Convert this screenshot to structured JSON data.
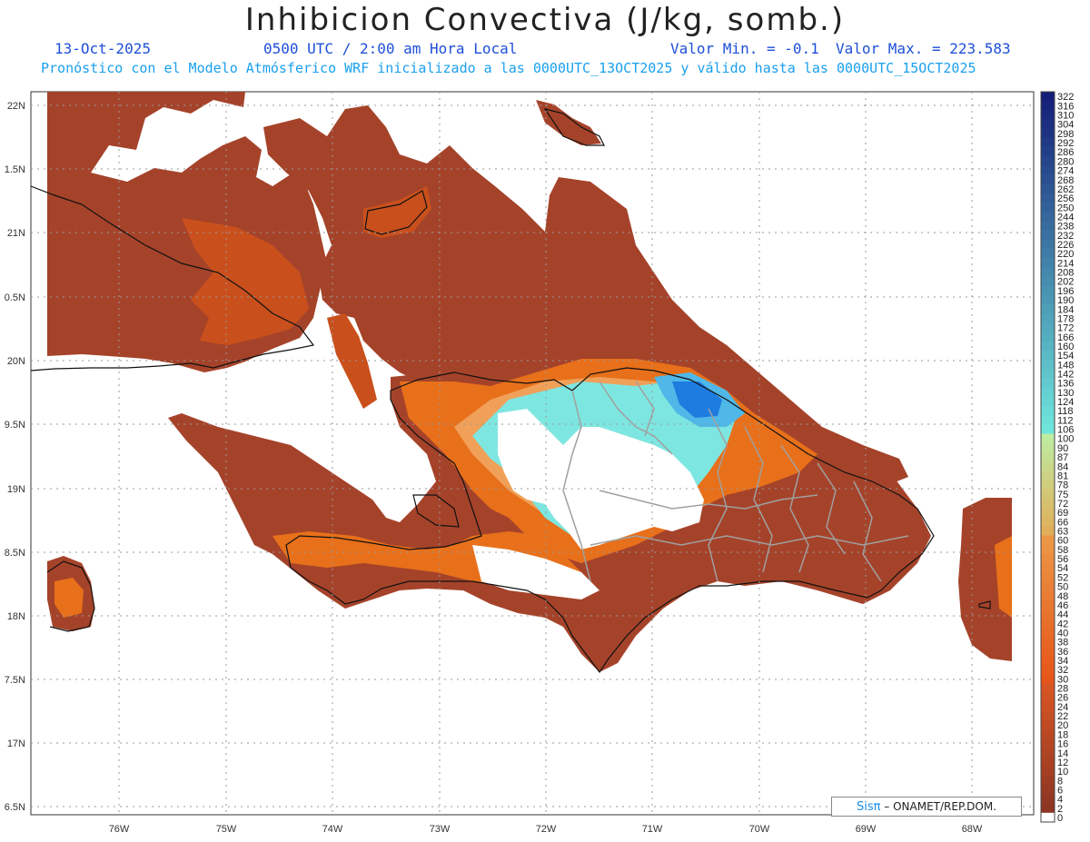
{
  "header": {
    "title": "Inhibicion Convectiva (J/kg, somb.)",
    "date": "13-Oct-2025",
    "time": "0500 UTC / 2:00 am Hora Local",
    "min_label": "Valor Min. = -0.1",
    "max_label": "Valor Max. = 223.583",
    "model_info": "Pronóstico con el Modelo Atmósferico WRF inicializado a las 0000UTC_13OCT2025 y válido hasta las  0000UTC_15OCT2025"
  },
  "map": {
    "lat_labels": [
      "22N",
      "1.5N",
      "21N",
      "0.5N",
      "20N",
      "9.5N",
      "19N",
      "8.5N",
      "18N",
      "7.5N",
      "17N",
      "6.5N"
    ],
    "lon_labels": [
      "76W",
      "75W",
      "74W",
      "73W",
      "72W",
      "71W",
      "70W",
      "69W",
      "68W"
    ],
    "colors": {
      "dark_brown": "#8a3a28",
      "brown": "#a5432a",
      "orange_red": "#c9501c",
      "orange": "#e8701a",
      "light_orange": "#f0a058",
      "cyan": "#7ee6e0",
      "light_blue": "#4fb8e8",
      "blue": "#1e7be0",
      "coast": "#111111",
      "borders": "#9a9a9a",
      "grid": "#999999"
    }
  },
  "colorbar": {
    "labels": [
      "322",
      "316",
      "310",
      "304",
      "298",
      "292",
      "286",
      "280",
      "274",
      "268",
      "262",
      "256",
      "250",
      "244",
      "238",
      "232",
      "226",
      "220",
      "214",
      "208",
      "202",
      "196",
      "190",
      "184",
      "178",
      "172",
      "166",
      "160",
      "154",
      "148",
      "142",
      "136",
      "130",
      "124",
      "118",
      "112",
      "106",
      "100",
      "90",
      "87",
      "84",
      "81",
      "78",
      "75",
      "72",
      "69",
      "66",
      "63",
      "60",
      "58",
      "56",
      "54",
      "52",
      "50",
      "48",
      "46",
      "44",
      "42",
      "40",
      "38",
      "36",
      "34",
      "32",
      "30",
      "28",
      "26",
      "24",
      "22",
      "20",
      "18",
      "16",
      "14",
      "12",
      "10",
      "8",
      "6",
      "4",
      "2",
      "0"
    ]
  },
  "credit": {
    "sis": "Sisπ",
    "text": "– ONAMET/REP.DOM."
  }
}
